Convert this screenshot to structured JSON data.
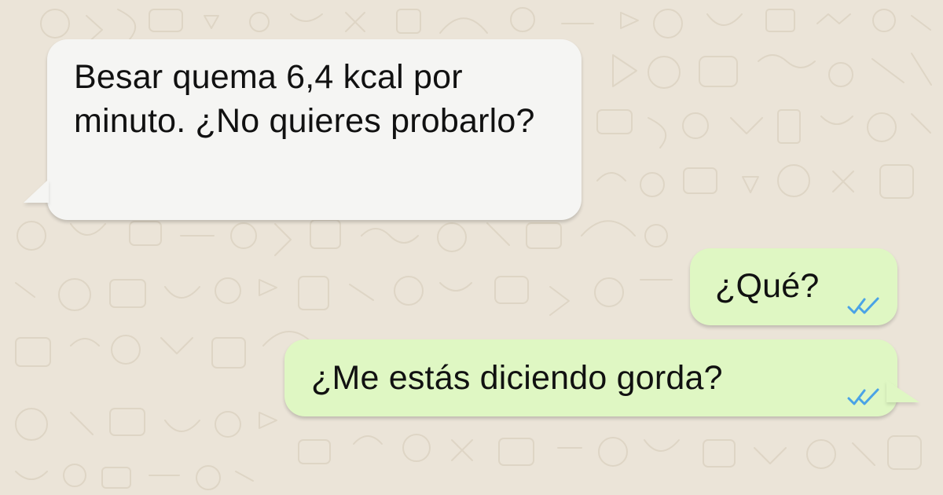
{
  "chat": {
    "messages": [
      {
        "direction": "incoming",
        "text": "Besar quema 6,4 kcal por minuto. ¿No quieres probarlo?"
      },
      {
        "direction": "outgoing",
        "text": "¿Qué?",
        "status_icon": "double-check-icon"
      },
      {
        "direction": "outgoing",
        "text": "¿Me estás diciendo gorda?",
        "status_icon": "double-check-icon"
      }
    ]
  },
  "colors": {
    "background": "#ebe4d8",
    "incoming_bubble": "#f5f5f3",
    "outgoing_bubble": "#dff7c3",
    "read_check": "#4aa3e6"
  }
}
